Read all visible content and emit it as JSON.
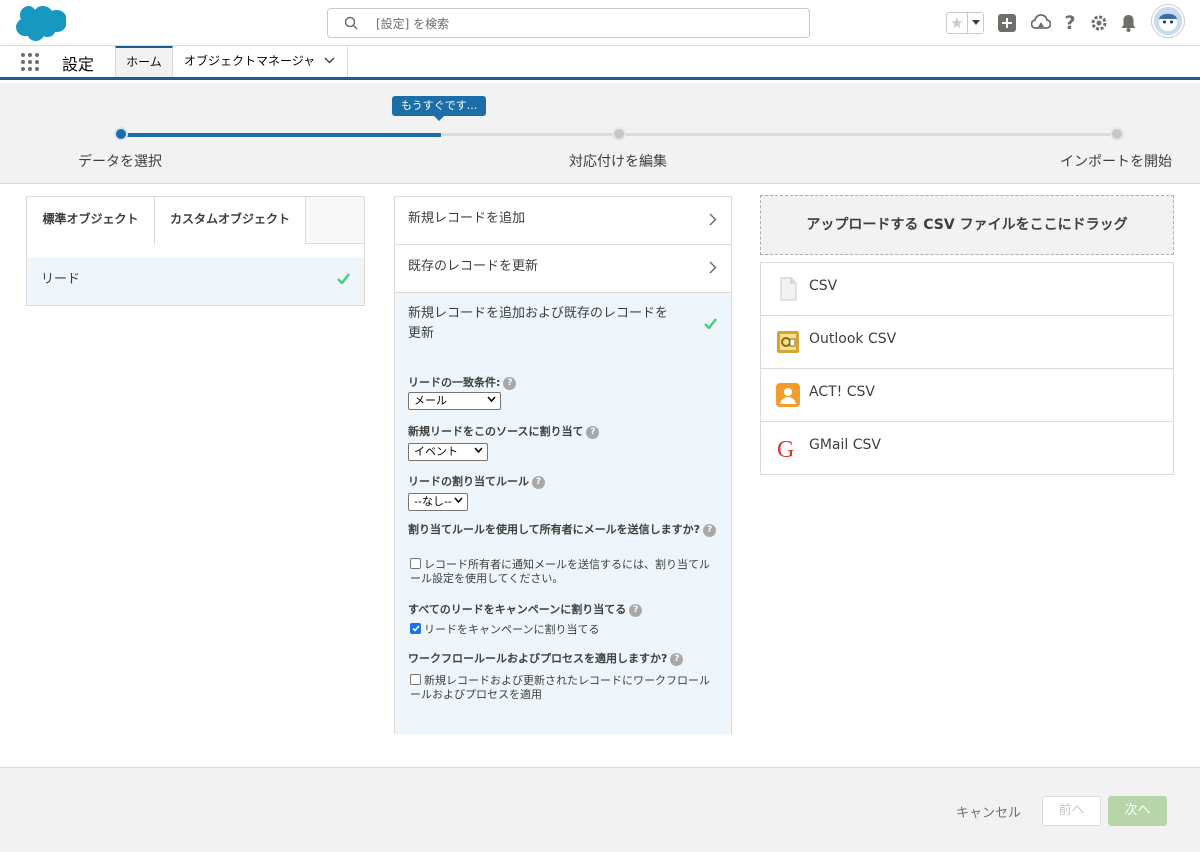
{
  "search": {
    "placeholder": "[設定] を検索"
  },
  "nav": {
    "app_title": "設定",
    "tab_home": "ホーム",
    "tab_object_manager": "オブジェクトマネージャ"
  },
  "progress": {
    "tooltip": "もうすぐです...",
    "current_step": 1,
    "fill_fraction": 0.32,
    "steps": [
      "データを選択",
      "対応付けを編集",
      "インポートを開始"
    ]
  },
  "object_tabs": {
    "standard": "標準オブジェクト",
    "custom": "カスタムオブジェクト"
  },
  "selected_object": "リード",
  "actions": [
    "新規レコードを追加",
    "既存のレコードを更新",
    "新規レコードを追加および既存のレコードを更新"
  ],
  "settings": {
    "match_label": "リードの一致条件:",
    "match_value": "メール",
    "source_label": "新規リードをこのソースに割り当て",
    "source_value": "イベント",
    "rule_label": "リードの割り当てルール",
    "rule_value": "--なし--",
    "email_label": "割り当てルールを使用して所有者にメールを送信しますか?",
    "email_checkbox": "レコード所有者に通知メールを送信するには、割り当てルール設定を使用してください。",
    "email_checked": false,
    "campaign_label": "すべてのリードをキャンペーンに割り当てる",
    "campaign_checkbox": "リードをキャンペーンに割り当てる",
    "campaign_checked": true,
    "workflow_label": "ワークフロールールおよびプロセスを適用しますか?",
    "workflow_checkbox": "新規レコードおよび更新されたレコードにワークフロールールおよびプロセスを適用",
    "workflow_checked": false
  },
  "upload": {
    "dropzone": "アップロードする CSV ファイルをここにドラッグ",
    "files": [
      {
        "label": "CSV",
        "icon": "csv-file-icon"
      },
      {
        "label": "Outlook CSV",
        "icon": "outlook-icon"
      },
      {
        "label": "ACT! CSV",
        "icon": "act-contact-icon"
      },
      {
        "label": "GMail CSV",
        "icon": "gmail-icon"
      }
    ]
  },
  "footer": {
    "cancel": "キャンセル",
    "prev": "前へ",
    "next": "次へ"
  },
  "colors": {
    "brand": "#1b6ea8",
    "check_green": "#4bca81",
    "next_button": "#b7d5a8"
  }
}
